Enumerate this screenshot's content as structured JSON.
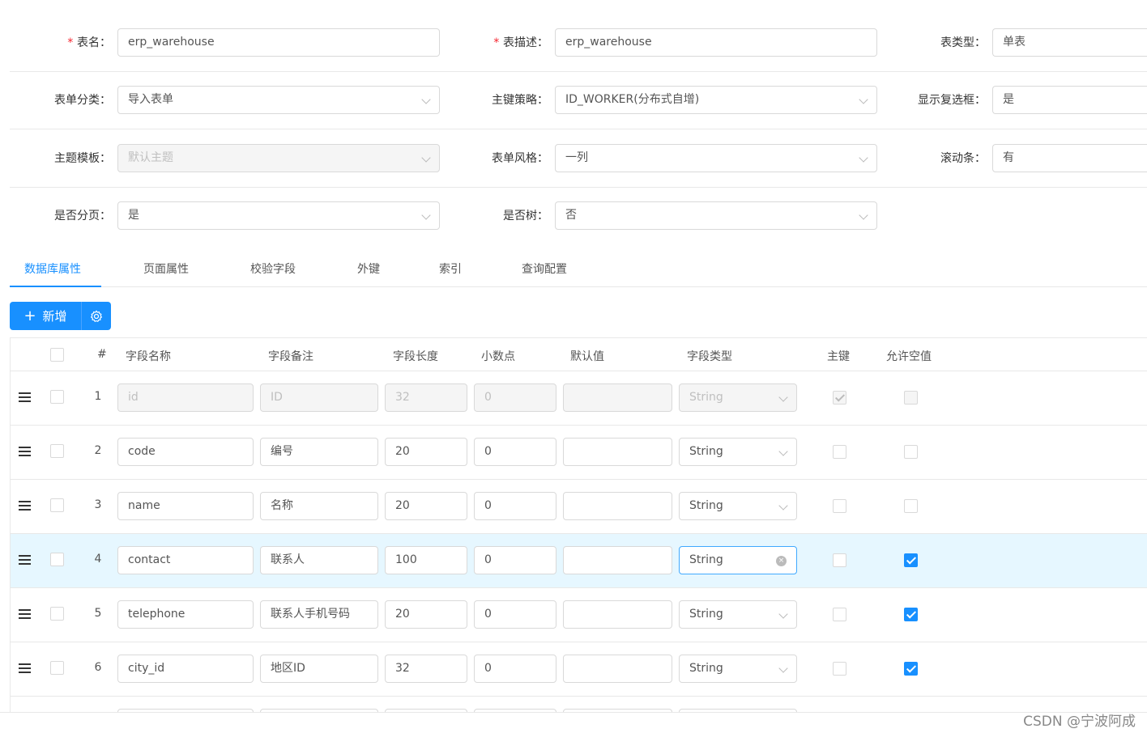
{
  "form": {
    "rows": [
      [
        {
          "label": "表名",
          "required": true,
          "value": "erp_warehouse",
          "type": "input"
        },
        {
          "label": "表描述",
          "required": true,
          "value": "erp_warehouse",
          "type": "input"
        },
        {
          "label": "表类型",
          "required": false,
          "value": "单表",
          "type": "input"
        }
      ],
      [
        {
          "label": "表单分类",
          "required": false,
          "value": "导入表单",
          "type": "select"
        },
        {
          "label": "主键策略",
          "required": false,
          "value": "ID_WORKER(分布式自增)",
          "type": "select"
        },
        {
          "label": "显示复选框",
          "required": false,
          "value": "是",
          "type": "input"
        }
      ],
      [
        {
          "label": "主题模板",
          "required": false,
          "value": "默认主题",
          "type": "select",
          "disabled": true
        },
        {
          "label": "表单风格",
          "required": false,
          "value": "一列",
          "type": "select"
        },
        {
          "label": "滚动条",
          "required": false,
          "value": "有",
          "type": "input"
        }
      ],
      [
        {
          "label": "是否分页",
          "required": false,
          "value": "是",
          "type": "select"
        },
        {
          "label": "是否树",
          "required": false,
          "value": "否",
          "type": "select"
        }
      ]
    ]
  },
  "tabs": [
    "数据库属性",
    "页面属性",
    "校验字段",
    "外键",
    "索引",
    "查询配置"
  ],
  "toolbar": {
    "add_label": "新增"
  },
  "table": {
    "headers": [
      "#",
      "字段名称",
      "字段备注",
      "字段长度",
      "小数点",
      "默认值",
      "字段类型",
      "主键",
      "允许空值"
    ],
    "rows": [
      {
        "no": "1",
        "name": "id",
        "remark": "ID",
        "length": "32",
        "decimal": "0",
        "default": "",
        "type": "String",
        "pk": true,
        "nullable": false,
        "disabled": true
      },
      {
        "no": "2",
        "name": "code",
        "remark": "编号",
        "length": "20",
        "decimal": "0",
        "default": "",
        "type": "String",
        "pk": false,
        "nullable": false
      },
      {
        "no": "3",
        "name": "name",
        "remark": "名称",
        "length": "20",
        "decimal": "0",
        "default": "",
        "type": "String",
        "pk": false,
        "nullable": false
      },
      {
        "no": "4",
        "name": "contact",
        "remark": "联系人",
        "length": "100",
        "decimal": "0",
        "default": "",
        "type": "String",
        "pk": false,
        "nullable": true,
        "highlight": true
      },
      {
        "no": "5",
        "name": "telephone",
        "remark": "联系人手机号码",
        "length": "20",
        "decimal": "0",
        "default": "",
        "type": "String",
        "pk": false,
        "nullable": true
      },
      {
        "no": "6",
        "name": "city_id",
        "remark": "地区ID",
        "length": "32",
        "decimal": "0",
        "default": "",
        "type": "String",
        "pk": false,
        "nullable": true
      }
    ]
  },
  "watermark": "CSDN @宁波阿成",
  "colors": {
    "primary": "#1890ff",
    "highlight": "#e6f7ff"
  }
}
